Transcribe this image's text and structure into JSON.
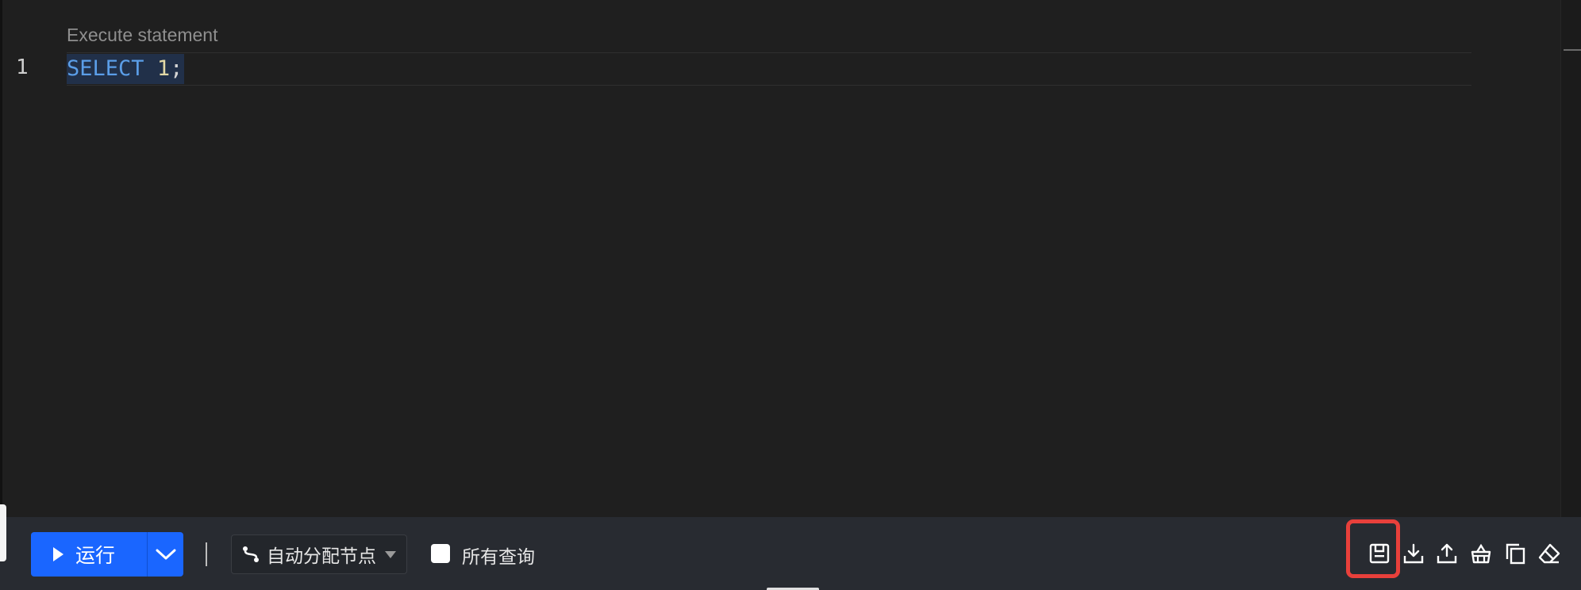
{
  "editor": {
    "hint": "Execute statement",
    "line_number": "1",
    "code": {
      "keyword": "SELECT",
      "value": "1",
      "terminator": ";"
    }
  },
  "toolbar": {
    "run_label": "运行",
    "node_select_value": "自动分配节点",
    "all_queries_label": "所有查询",
    "all_queries_checked": false,
    "icons": [
      "save-icon",
      "download-icon",
      "upload-icon",
      "basket-icon",
      "copy-icon",
      "eraser-icon"
    ]
  },
  "colors": {
    "run_button": "#1a66ff",
    "highlight_border": "#e8403b",
    "keyword": "#5b9ee8",
    "number": "#e2d9a6"
  }
}
